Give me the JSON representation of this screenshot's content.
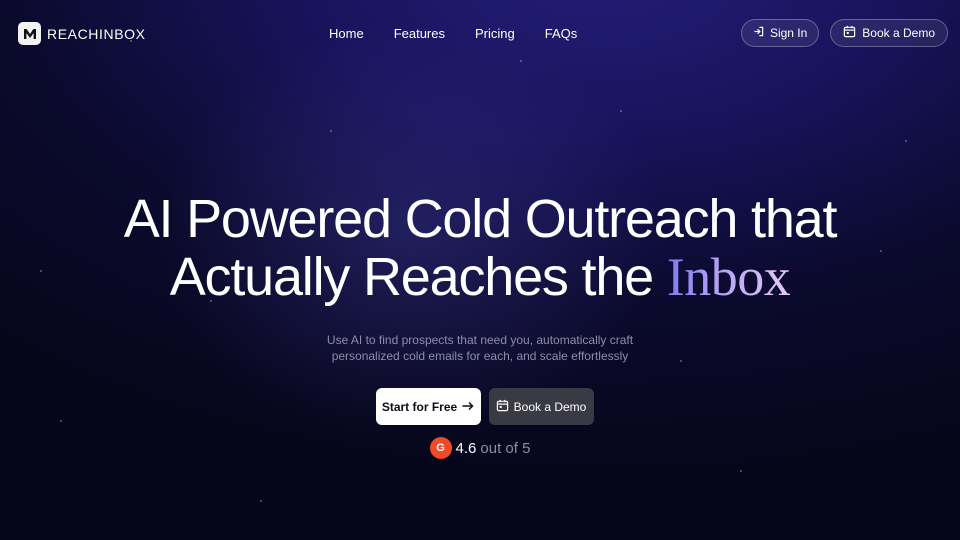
{
  "brand": {
    "name": "REACHINBOX",
    "logo_letter": "M",
    "logo_color": "#f2f2f2"
  },
  "nav": {
    "items": [
      {
        "label": "Home"
      },
      {
        "label": "Features"
      },
      {
        "label": "Pricing"
      },
      {
        "label": "FAQs"
      }
    ]
  },
  "header_actions": {
    "sign_in_label": "Sign In",
    "sign_in_icon": "sign-in-icon",
    "book_demo_label": "Book a Demo",
    "book_demo_icon": "calendar-icon"
  },
  "hero": {
    "title_line1": "AI Powered Cold Outreach that",
    "title_line2_prefix": "Actually Reaches the",
    "title_highlight": "Inbox",
    "highlight_gradient": [
      "#7e7cf0",
      "#b7a3f3",
      "#e3c9f7"
    ],
    "subtitle_line1": "Use AI to find prospects that need you, automatically craft",
    "subtitle_line2": "personalized cold emails for each, and scale effortlessly"
  },
  "cta": {
    "primary_label": "Start for Free",
    "primary_icon": "arrow-right-icon",
    "secondary_label": "Book a Demo",
    "secondary_icon": "calendar-icon"
  },
  "rating": {
    "badge_icon": "g2-logo-icon",
    "badge_letter": "G",
    "badge_color": "#ef4a2a",
    "value": "4.6",
    "suffix": "out of 5"
  },
  "colors": {
    "background_top": "#241e78",
    "background_bottom": "#06061a",
    "subtitle_text": "#8f8da6",
    "secondary_button": "#3a3a45"
  }
}
